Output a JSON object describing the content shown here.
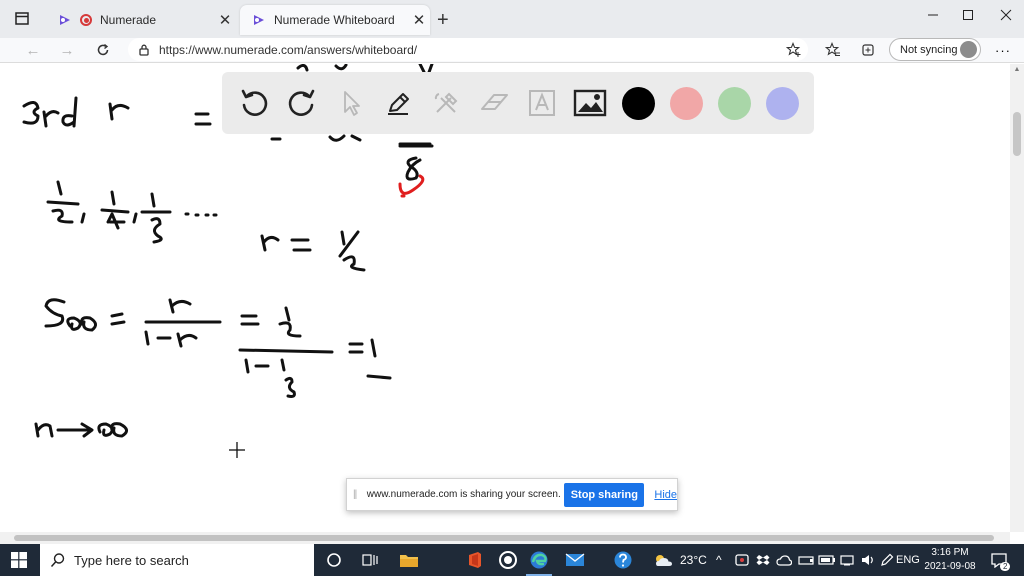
{
  "browser": {
    "tabs": [
      {
        "title": "Numerade",
        "recording": true
      },
      {
        "title": "Numerade Whiteboard",
        "active": true
      }
    ],
    "url": "https://www.numerade.com/answers/whiteboard/",
    "sync_label": "Not syncing"
  },
  "whiteboard": {
    "tools": [
      "undo-icon",
      "redo-icon",
      "pointer-icon",
      "pen-icon",
      "tools-icon",
      "eraser-icon",
      "text-icon",
      "image-icon"
    ],
    "colors": {
      "black": "#000000",
      "red": "#f1a7a7",
      "green": "#a9d6a8",
      "purple": "#aeb2ef"
    },
    "ink_color": "#111111",
    "accent_ink": "#e01e1e"
  },
  "share_bar": {
    "message": "www.numerade.com is sharing your screen.",
    "stop_label": "Stop sharing",
    "hide_label": "Hide"
  },
  "taskbar": {
    "search_placeholder": "Type here to search",
    "weather": "23°C",
    "language": "ENG",
    "time": "3:16 PM",
    "date": "2021-09-08",
    "notification_count": "2"
  }
}
